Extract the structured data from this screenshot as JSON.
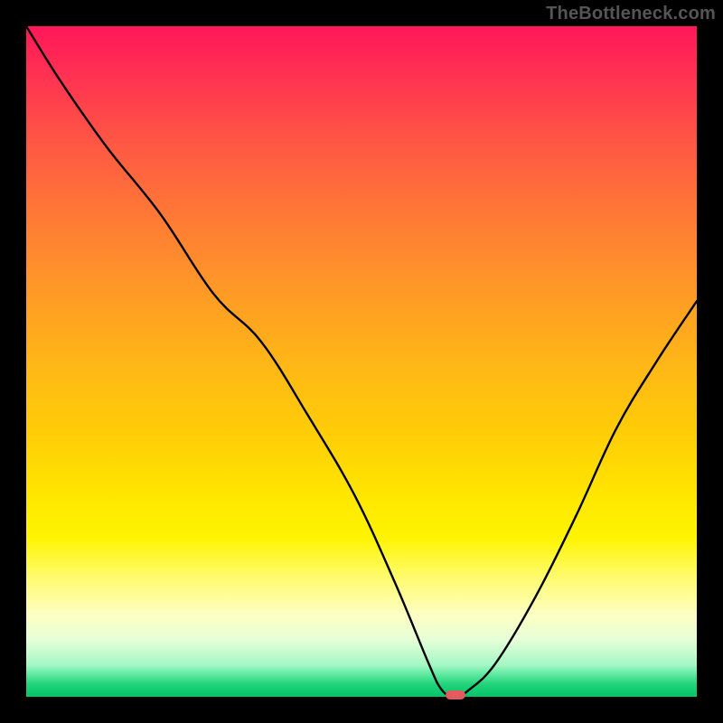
{
  "watermark": "TheBottleneck.com",
  "chart_data": {
    "type": "line",
    "title": "",
    "xlabel": "",
    "ylabel": "",
    "xlim": [
      0,
      100
    ],
    "ylim": [
      0,
      100
    ],
    "x": [
      0,
      5,
      12,
      20,
      28,
      35,
      42,
      49,
      55,
      60,
      62,
      64,
      66,
      70,
      76,
      82,
      88,
      94,
      100
    ],
    "values": [
      100,
      92,
      82,
      72,
      60,
      53,
      42,
      30,
      17,
      5,
      1,
      0,
      1,
      5,
      15,
      27,
      40,
      50,
      59
    ],
    "marker": {
      "x": 64,
      "y": 0
    },
    "gradient_stops": [
      {
        "pct": 0,
        "color": "#ff1758"
      },
      {
        "pct": 30,
        "color": "#ff7a35"
      },
      {
        "pct": 65,
        "color": "#ffd006"
      },
      {
        "pct": 92,
        "color": "#fdffc2"
      },
      {
        "pct": 100,
        "color": "#04c567"
      }
    ]
  }
}
